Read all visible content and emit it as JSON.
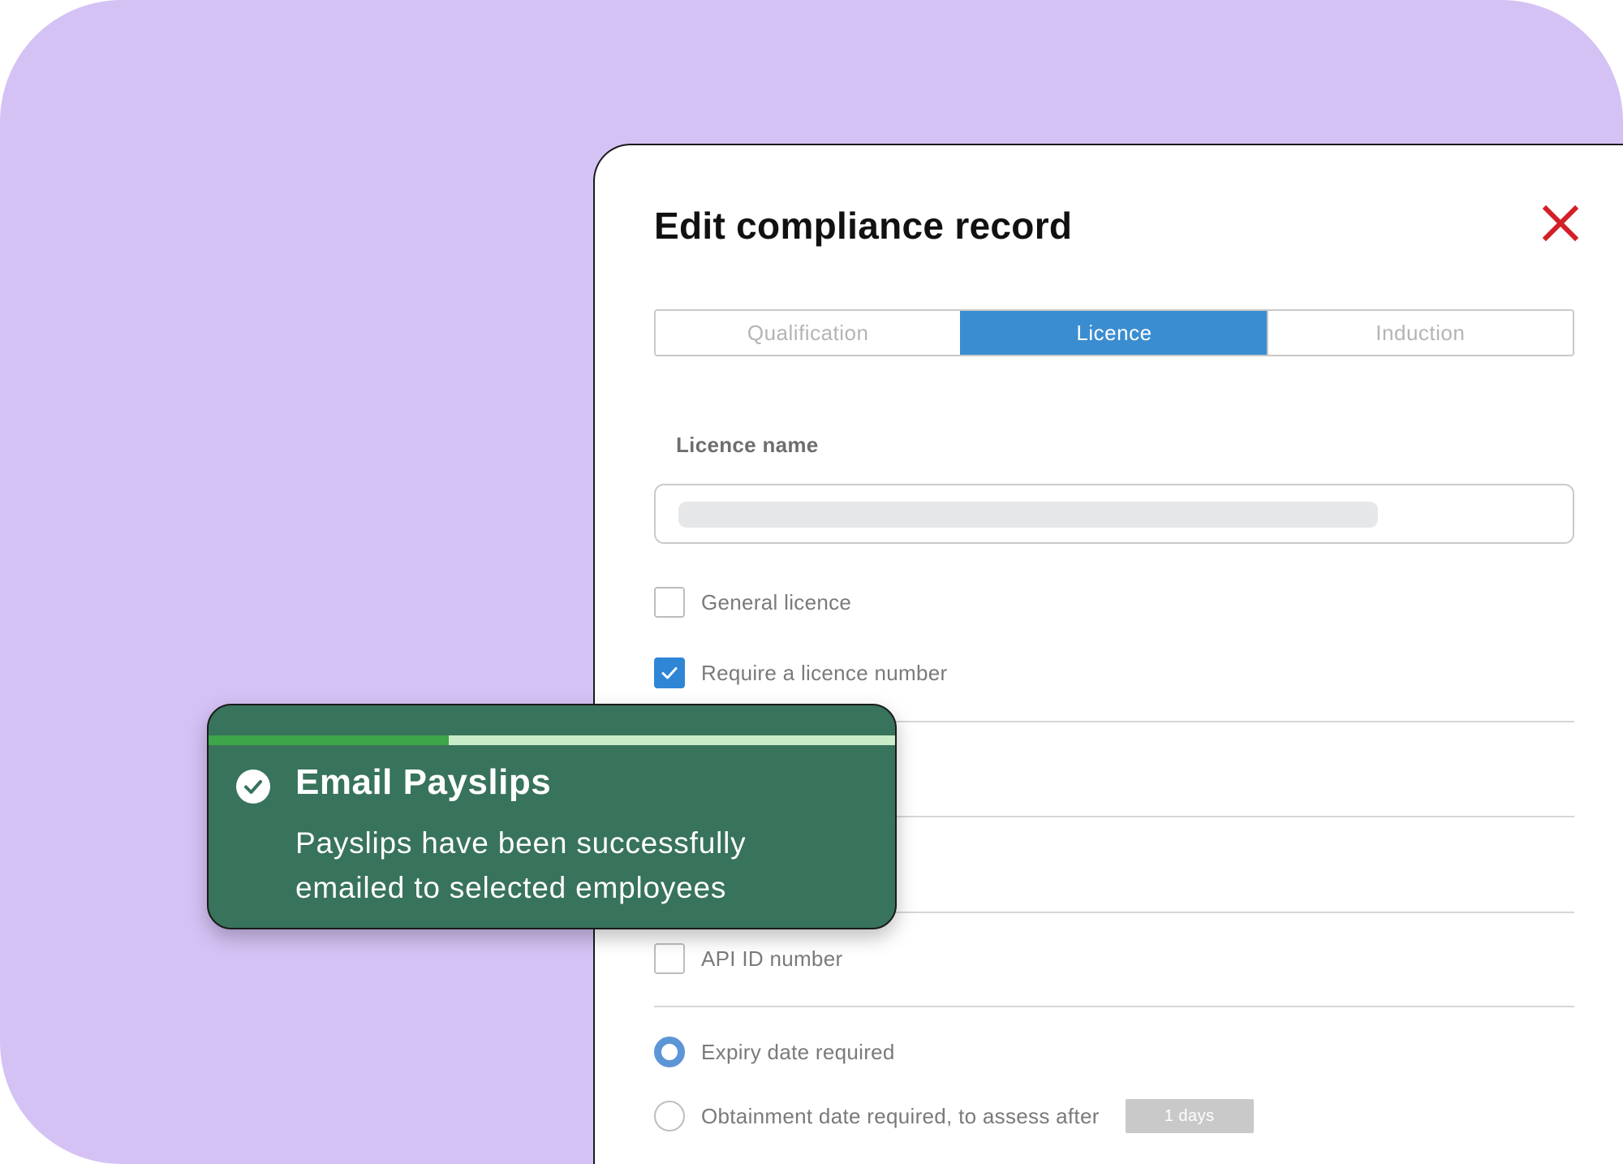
{
  "dialog": {
    "title": "Edit compliance record",
    "tabs": [
      {
        "label": "Qualification",
        "active": false
      },
      {
        "label": "Licence",
        "active": true
      },
      {
        "label": "Induction",
        "active": false
      }
    ],
    "licence_name": {
      "label": "Licence name",
      "value": ""
    },
    "options": [
      {
        "label": "General licence",
        "checked": false
      },
      {
        "label": "Require a licence number",
        "checked": true
      },
      {
        "label": "API ID number",
        "checked": false
      }
    ],
    "date_options": [
      {
        "label": "Expiry date required",
        "selected": true
      },
      {
        "label": "Obtainment date required, to assess after",
        "selected": false
      }
    ],
    "days_value": "1 days"
  },
  "toast": {
    "title": "Email Payslips",
    "message_line1": "Payslips have been successfully",
    "message_line2": "emailed to selected employees",
    "progress": 0.35
  },
  "colors": {
    "background": "#d5c2f5",
    "accent": "#3a8dd0",
    "close": "#d32028",
    "toast_bg": "#38735c",
    "toast_progress": "#3da64a"
  }
}
